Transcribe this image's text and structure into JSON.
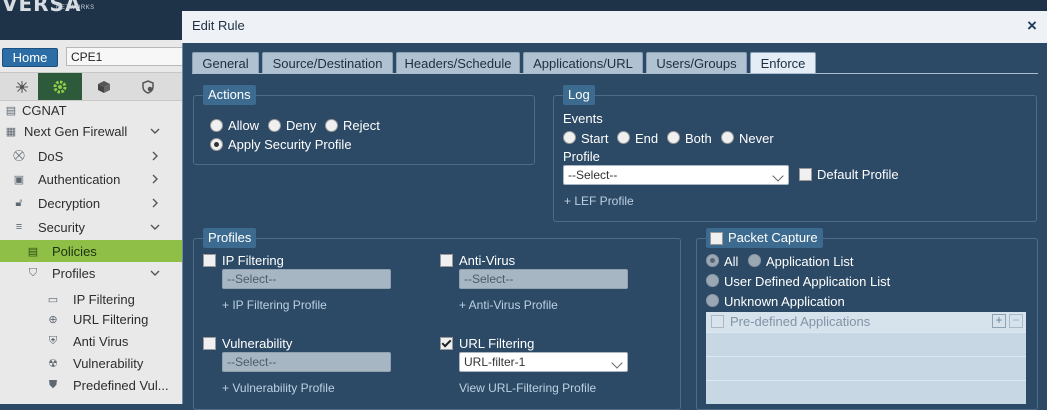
{
  "app": {
    "logo": "VERSA",
    "logo_sub": "NETWORKS"
  },
  "nav_header": {
    "home_label": "Home",
    "appliance": "CPE1"
  },
  "icon_tabs": [
    "network-icon",
    "gear-icon",
    "cube-icon",
    "shield-gear-icon"
  ],
  "sidebar": {
    "items": [
      {
        "label": "CGNAT",
        "icon": "cgnat-icon"
      },
      {
        "label": "Next Gen Firewall",
        "icon": "firewall-icon"
      },
      {
        "label": "DoS",
        "icon": "dos-icon"
      },
      {
        "label": "Authentication",
        "icon": "authentication-icon"
      },
      {
        "label": "Decryption",
        "icon": "decryption-icon"
      },
      {
        "label": "Security",
        "icon": "security-icon"
      },
      {
        "label": "Policies",
        "icon": "policies-icon"
      },
      {
        "label": "Profiles",
        "icon": "profiles-icon"
      },
      {
        "label": "IP Filtering",
        "icon": "monitor-icon"
      },
      {
        "label": "URL Filtering",
        "icon": "globe-icon"
      },
      {
        "label": "Anti Virus",
        "icon": "virus-shield-icon"
      },
      {
        "label": "Vulnerability",
        "icon": "vulnerability-icon"
      },
      {
        "label": "Predefined Vul...",
        "icon": "predefined-icon"
      }
    ]
  },
  "dialog": {
    "title": "Edit Rule",
    "close": "×",
    "tabs": [
      "General",
      "Source/Destination",
      "Headers/Schedule",
      "Applications/URL",
      "Users/Groups",
      "Enforce"
    ],
    "active_tab": "Enforce"
  },
  "actions": {
    "legend": "Actions",
    "options": [
      "Allow",
      "Deny",
      "Reject",
      "Apply Security Profile"
    ],
    "selected": "Apply Security Profile"
  },
  "log": {
    "legend": "Log",
    "events_label": "Events",
    "events": [
      "Start",
      "End",
      "Both",
      "Never"
    ],
    "profile_label": "Profile",
    "profile_value": "--Select--",
    "default_profile_label": "Default Profile",
    "lef_link": "+ LEF Profile"
  },
  "profiles": {
    "legend": "Profiles",
    "ip_filtering": {
      "label": "IP Filtering",
      "checked": false,
      "value": "--Select--",
      "link": "+ IP Filtering Profile"
    },
    "anti_virus": {
      "label": "Anti-Virus",
      "checked": false,
      "value": "--Select--",
      "link": "+ Anti-Virus Profile"
    },
    "vulnerability": {
      "label": "Vulnerability",
      "checked": false,
      "value": "--Select--",
      "link": "+ Vulnerability Profile"
    },
    "url_filtering": {
      "label": "URL Filtering",
      "checked": true,
      "value": "URL-filter-1",
      "link": "View URL-Filtering Profile"
    }
  },
  "packet_capture": {
    "legend": "Packet Capture",
    "options": [
      "All",
      "Application List",
      "User Defined Application List",
      "Unknown Application"
    ],
    "selected": "All",
    "grid_header": "Pre-defined Applications"
  }
}
